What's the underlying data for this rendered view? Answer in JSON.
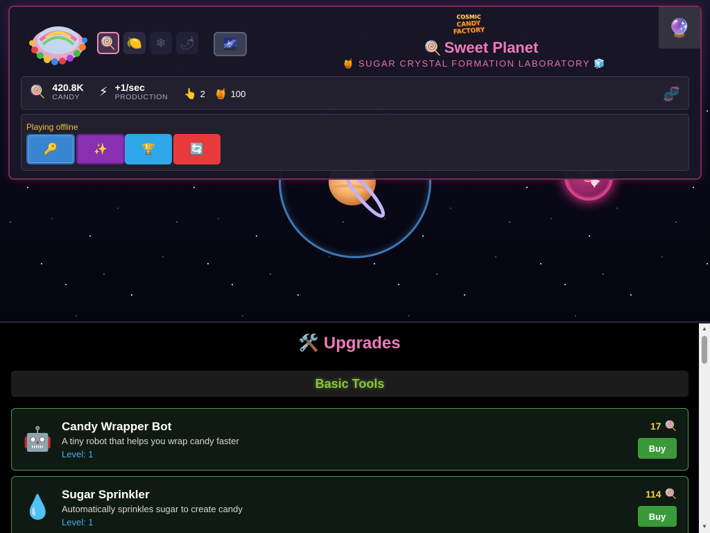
{
  "header": {
    "logo_text_top": "COSMIC",
    "logo_text_bottom": "CANDY FACTORY",
    "planet_name": "Sweet Planet",
    "subtitle": "SUGAR CRYSTAL FORMATION LABORATORY",
    "themes": [
      "lollipop",
      "lemon",
      "snowflake",
      "pepper"
    ],
    "galaxy_button_icon": "galaxy-icon"
  },
  "stats": {
    "candy_value": "420.8K",
    "candy_label": "CANDY",
    "production_value": "+1/sec",
    "production_label": "PRODUCTION",
    "clicks": "2",
    "honey": "100"
  },
  "actions": {
    "status": "Playing offline",
    "buttons": [
      "key",
      "magic",
      "trophy",
      "reset"
    ]
  },
  "upgrades": {
    "title": "Upgrades",
    "category": "Basic Tools",
    "items": [
      {
        "name": "Candy Wrapper Bot",
        "description": "A tiny robot that helps you wrap candy faster",
        "level_label": "Level: 1",
        "cost": "17",
        "buy_label": "Buy",
        "icon": "robot-icon"
      },
      {
        "name": "Sugar Sprinkler",
        "description": "Automatically sprinkles sugar to create candy",
        "level_label": "Level: 1",
        "cost": "114",
        "buy_label": "Buy",
        "icon": "droplet-icon"
      }
    ]
  },
  "colors": {
    "accent_pink": "#f07ab8",
    "category_green": "#8ac43a",
    "cost_yellow": "#f0d040",
    "level_blue": "#4aa8f0",
    "buy_green": "#3a9a3a"
  }
}
